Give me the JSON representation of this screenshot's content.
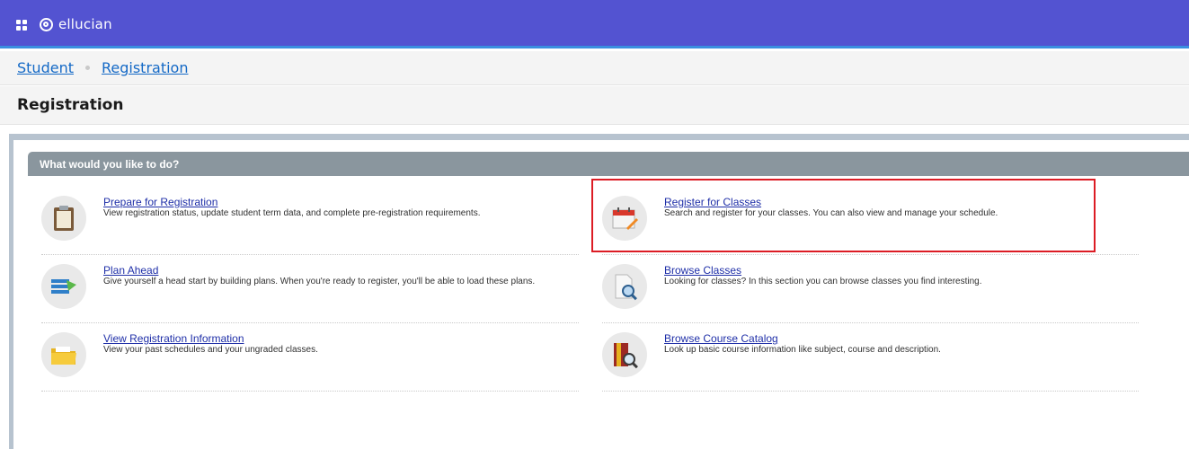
{
  "header": {
    "brand": "ellucian",
    "menu_icon": "grid-menu-icon",
    "logo_icon": "ellucian-logo-icon",
    "color": "#5353d1",
    "accent": "#3a8fe0"
  },
  "breadcrumb": {
    "items": [
      "Student",
      "Registration"
    ]
  },
  "page": {
    "title": "Registration"
  },
  "panel": {
    "heading": "What would you like to do?",
    "items": [
      {
        "title": "Prepare for Registration",
        "description": "View registration status, update student term data, and complete pre-registration requirements.",
        "icon": "clipboard-icon"
      },
      {
        "title": "Register for Classes",
        "description": "Search and register for your classes. You can also view and manage your schedule.",
        "icon": "calendar-edit-icon",
        "highlighted": true
      },
      {
        "title": "Plan Ahead",
        "description": "Give yourself a head start by building plans. When you're ready to register, you'll be able to load these plans.",
        "icon": "plan-list-icon"
      },
      {
        "title": "Browse Classes",
        "description": "Looking for classes? In this section you can browse classes you find interesting.",
        "icon": "document-search-icon"
      },
      {
        "title": "View Registration Information",
        "description": "View your past schedules and your ungraded classes.",
        "icon": "folder-icon"
      },
      {
        "title": "Browse Course Catalog",
        "description": "Look up basic course information like subject, course and description.",
        "icon": "book-search-icon"
      }
    ],
    "highlight_color": "#dc1c24"
  }
}
